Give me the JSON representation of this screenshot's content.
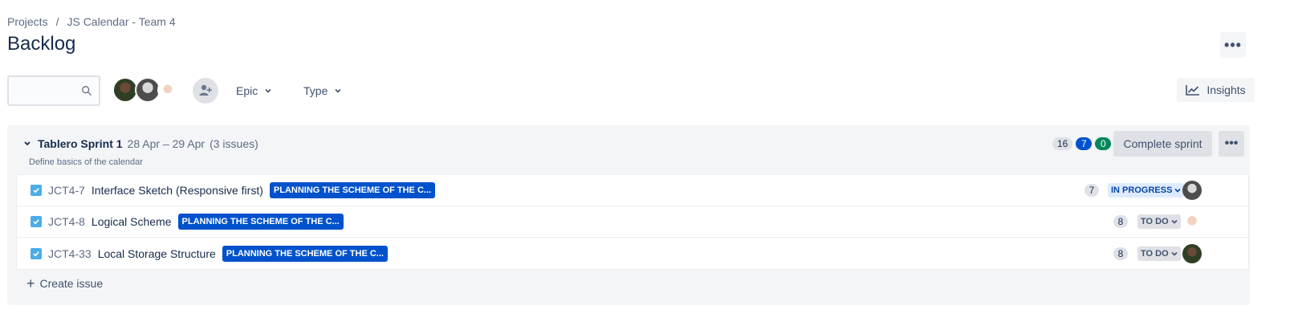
{
  "breadcrumb": {
    "projects": "Projects",
    "separator": "/",
    "project_name": "JS Calendar - Team 4"
  },
  "page": {
    "title": "Backlog",
    "more_label": "•••"
  },
  "search": {
    "placeholder": "",
    "value": ""
  },
  "filters": {
    "epic_label": "Epic",
    "type_label": "Type"
  },
  "insights": {
    "label": "Insights"
  },
  "sprint": {
    "name": "Tablero Sprint 1",
    "dates": "28 Apr – 29 Apr",
    "issue_count": "(3 issues)",
    "goal": "Define basics of the calendar",
    "counts": {
      "todo": "16",
      "in_progress": "7",
      "done": "0"
    },
    "complete_label": "Complete sprint",
    "more_label": "•••",
    "issues": [
      {
        "key": "JCT4-7",
        "summary": "Interface Sketch (Responsive first)",
        "epic": "PLANNING THE SCHEME OF THE C...",
        "points": "7",
        "status": "IN PROGRESS"
      },
      {
        "key": "JCT4-8",
        "summary": "Logical Scheme",
        "epic": "PLANNING THE SCHEME OF THE C...",
        "points": "8",
        "status": "TO DO"
      },
      {
        "key": "JCT4-33",
        "summary": "Local Storage Structure",
        "epic": "PLANNING THE SCHEME OF THE C...",
        "points": "8",
        "status": "TO DO"
      }
    ],
    "create_label": "Create issue"
  },
  "colors": {
    "accent": "#0052cc",
    "done": "#00875a",
    "checkbox": "#4bade8",
    "in_progress_bg": "#deebff"
  }
}
